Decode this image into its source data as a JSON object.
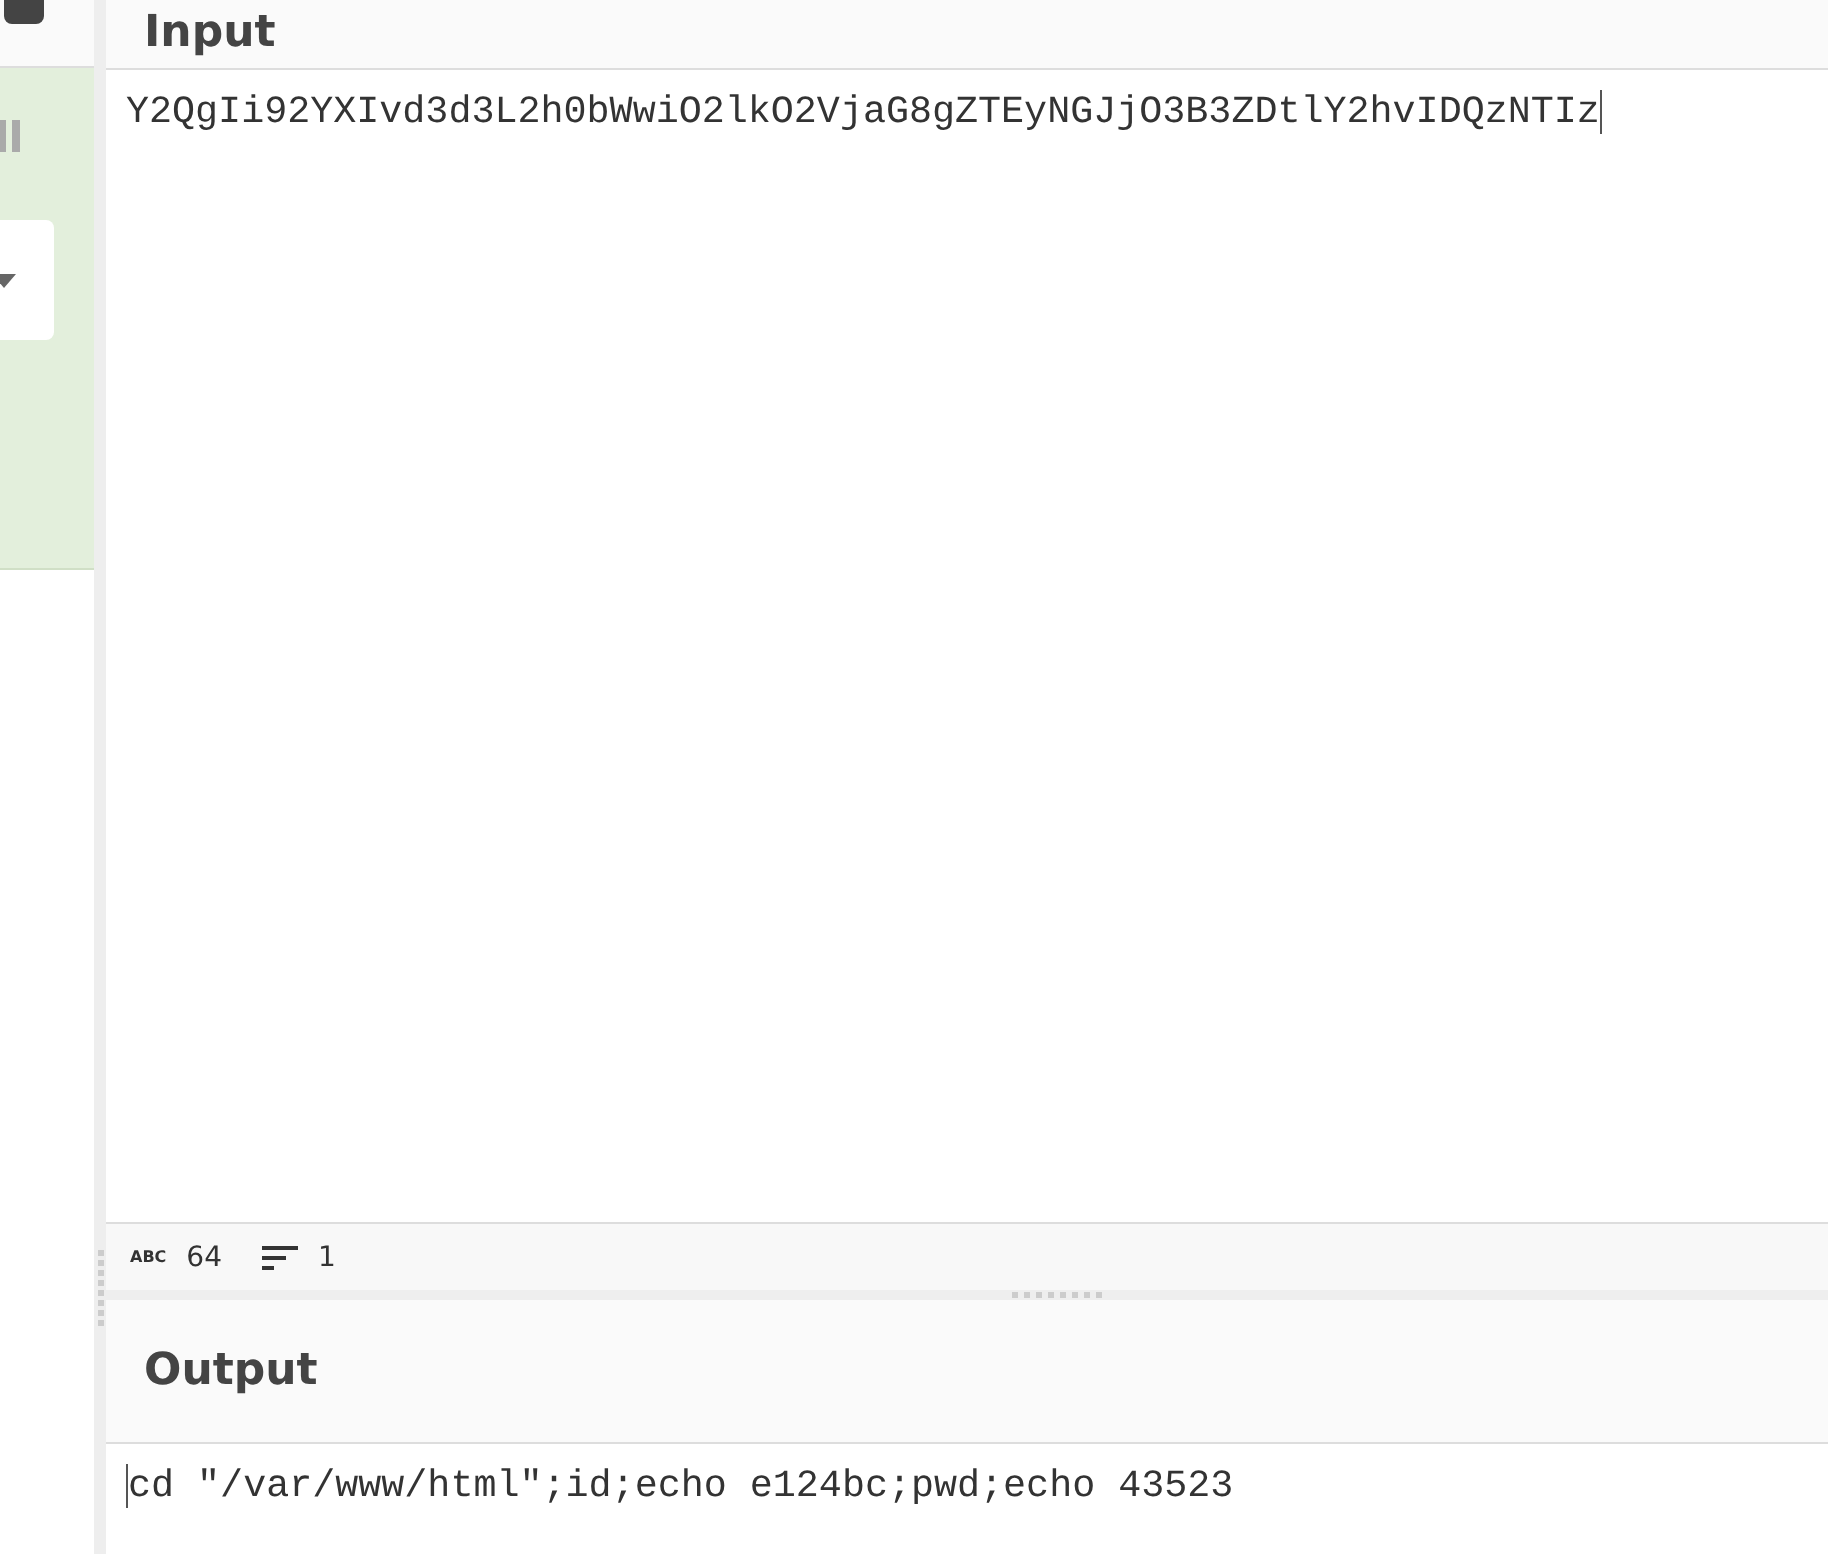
{
  "input": {
    "title": "Input",
    "value": "Y2QgIi92YXIvd3d3L2h0bWwiO2lkO2VjaG8gZTEyNGJjO3B3ZDtlY2hvIDQzNTIz"
  },
  "status_bar": {
    "length_icon": "ABC",
    "length": "64",
    "lines": "1"
  },
  "output": {
    "title": "Output",
    "value": "cd \"/var/www/html\";id;echo e124bc;pwd;echo 43523"
  }
}
